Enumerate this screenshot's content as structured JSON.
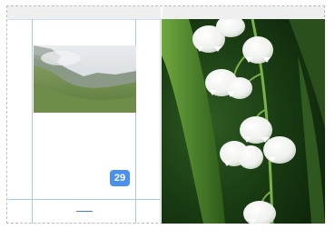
{
  "panel": {
    "badge_count": "29"
  },
  "images": {
    "thumbnail": "mountain-valley-photo",
    "main": "lily-of-the-valley-photo"
  },
  "colors": {
    "accent": "#4a90f0",
    "guide": "#a9c9ef",
    "frame_border": "#bdbdbd"
  }
}
